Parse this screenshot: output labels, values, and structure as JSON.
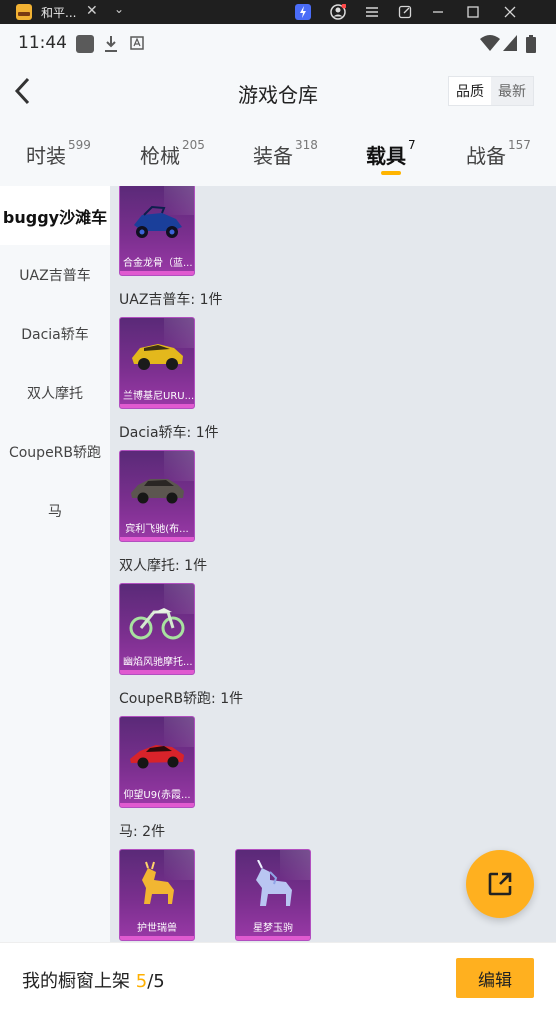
{
  "window": {
    "tab_title": "和平...",
    "tab_close": "✕",
    "tab_dropdown": "⌄",
    "accent_icon_color": "#4a6cf7"
  },
  "status_bar": {
    "time": "11:44",
    "icons": [
      "square-icon",
      "download-icon",
      "text-icon",
      "wifi-icon",
      "signal-icon",
      "battery-icon"
    ]
  },
  "header": {
    "title": "游戏仓库",
    "sort_options": [
      "品质",
      "最新"
    ],
    "sort_active": "品质"
  },
  "categories": [
    {
      "label": "时装",
      "count": "599"
    },
    {
      "label": "枪械",
      "count": "205"
    },
    {
      "label": "装备",
      "count": "318"
    },
    {
      "label": "载具",
      "count": "7"
    },
    {
      "label": "战备",
      "count": "157"
    }
  ],
  "active_category": "载具",
  "sidebar": {
    "items": [
      "buggy沙滩车",
      "UAZ吉普车",
      "Dacia轿车",
      "双人摩托",
      "CoupeRB轿跑",
      "马"
    ],
    "active": "buggy沙滩车"
  },
  "sections": [
    {
      "title": "",
      "items": [
        {
          "name": "合金龙骨（蓝..."
        }
      ]
    },
    {
      "title": "UAZ吉普车: 1件",
      "items": [
        {
          "name": "兰博基尼URU..."
        }
      ]
    },
    {
      "title": "Dacia轿车: 1件",
      "items": [
        {
          "name": "宾利飞驰(布..."
        }
      ]
    },
    {
      "title": "双人摩托: 1件",
      "items": [
        {
          "name": "幽焰风驰摩托..."
        }
      ]
    },
    {
      "title": "CoupeRB轿跑: 1件",
      "items": [
        {
          "name": "仰望U9(赤霞..."
        }
      ]
    },
    {
      "title": "马: 2件",
      "items": [
        {
          "name": "护世瑞兽"
        },
        {
          "name": "星梦玉驹"
        }
      ]
    }
  ],
  "bottom_bar": {
    "label": "我的橱窗上架",
    "shelf_count": "5",
    "shelf_total": "/5",
    "edit_label": "编辑"
  },
  "colors": {
    "accent": "#ffb01f",
    "card_bg": "#7a2f8e",
    "background": "#f6f8fa",
    "content_bg": "#e4e8ed"
  }
}
